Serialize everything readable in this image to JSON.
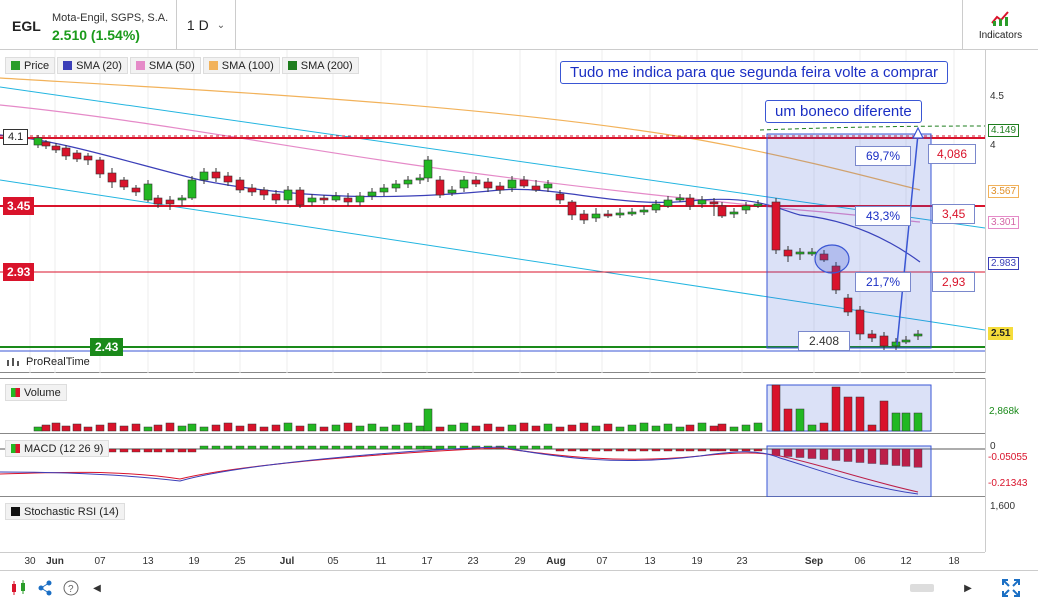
{
  "header": {
    "symbol": "EGL",
    "company": "Mota-Engil, SGPS, S.A.",
    "price": "2.510 (1.54%)",
    "timeframe": "1 D",
    "indicators_label": "Indicators"
  },
  "legend": [
    {
      "label": "Price",
      "color": "#2a9d2a"
    },
    {
      "label": "SMA (20)",
      "color": "#3b3fb8"
    },
    {
      "label": "SMA (50)",
      "color": "#e58ac8"
    },
    {
      "label": "SMA (100)",
      "color": "#f2b25a"
    },
    {
      "label": "SMA (200)",
      "color": "#1e7d1e"
    }
  ],
  "notes": {
    "main": "Tudo me indica para que segunda feira volte a comprar",
    "second": "um boneco diferente"
  },
  "levels": {
    "l41": "4.1",
    "l345": "3.45",
    "l293": "2.93",
    "l243": "2.43"
  },
  "box_labels": {
    "p697": "69,7%",
    "p433": "43,3%",
    "p217": "21,7%",
    "v4086": "4,086",
    "v345": "3,45",
    "v293": "2,93",
    "v2408": "2.408"
  },
  "price_axis": {
    "t45": "4.5",
    "t4": "4",
    "lbl_4149": "4.149",
    "lbl_3567": "3.567",
    "lbl_3301": "3.301",
    "lbl_2983": "2.983",
    "lbl_251": "2.51"
  },
  "prorealtime": "ProRealTime",
  "volume": {
    "label": "Volume",
    "axis_value": "2,868k"
  },
  "macd": {
    "label": "MACD (12 26 9)",
    "zero": "0",
    "v1": "-0.05055",
    "v2": "-0.21343"
  },
  "stoch": {
    "label": "Stochastic RSI (14)",
    "axis_value": "1,600"
  },
  "x_axis": [
    "30",
    "Jun",
    "07",
    "13",
    "19",
    "25",
    "Jul",
    "05",
    "11",
    "17",
    "23",
    "29",
    "Aug",
    "07",
    "13",
    "19",
    "23",
    "Sep",
    "06",
    "12",
    "18"
  ],
  "colors": {
    "up": "#22b822",
    "down": "#d9132b",
    "sma20": "#3b3fb8",
    "sma50": "#e58ac8",
    "sma100": "#f2b25a",
    "sma200": "#1e7d1e",
    "trend": "#22b5e0",
    "box": "#3a56d4",
    "red_line": "#d9132b",
    "green_line": "#1a8a1a"
  }
}
